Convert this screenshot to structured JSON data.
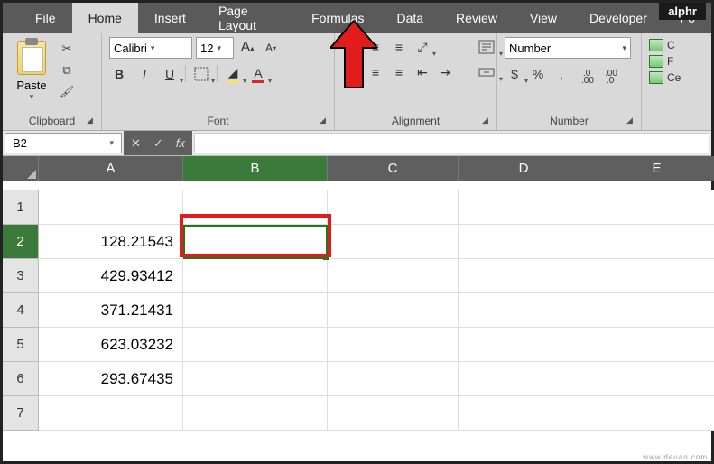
{
  "app": {
    "brand": "alphr"
  },
  "tabs": [
    "File",
    "Home",
    "Insert",
    "Page Layout",
    "Formulas",
    "Data",
    "Review",
    "View",
    "Developer",
    "Po"
  ],
  "active_tab": "Home",
  "arrow_points_to_tab": "Formulas",
  "ribbon": {
    "clipboard": {
      "label": "Clipboard",
      "paste": "Paste"
    },
    "font": {
      "label": "Font",
      "name": "Calibri",
      "size": "12",
      "grow": "A",
      "shrink": "A",
      "bold": "B",
      "italic": "I",
      "underline": "U",
      "font_color_letter": "A"
    },
    "alignment": {
      "label": "Alignment"
    },
    "number": {
      "label": "Number",
      "format": "Number",
      "currency": "$",
      "percent": "%",
      "comma": ",",
      "inc": ".0",
      "dec": ".00"
    },
    "cells": {
      "c": "C",
      "f": "F",
      "ce": "Ce"
    }
  },
  "formula_bar": {
    "name_box": "B2",
    "fx": "fx",
    "cancel": "✕",
    "accept": "✓",
    "formula": ""
  },
  "grid": {
    "columns": [
      "A",
      "B",
      "C",
      "D",
      "E"
    ],
    "rows": [
      "1",
      "2",
      "3",
      "4",
      "5",
      "6",
      "7"
    ],
    "active_cell": "B2",
    "data": {
      "A2": "128.21543",
      "A3": "429.93412",
      "A4": "371.21431",
      "A5": "623.03232",
      "A6": "293.67435"
    }
  },
  "watermark": "www.deuao.com"
}
